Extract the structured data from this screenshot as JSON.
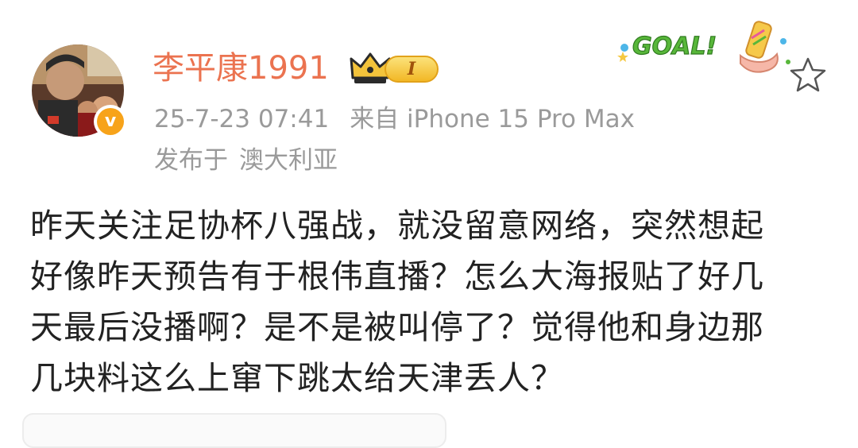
{
  "post": {
    "username": "李平康1991",
    "level_badge": "I",
    "verified_badge": "v",
    "timestamp": "25-7-23 07:41",
    "source": "来自 iPhone 15 Pro Max",
    "location_prefix": "发布于",
    "location": "澳大利亚",
    "sticker_text": "GOAL!",
    "content_lines": [
      "昨天关注足协杯八强战，就没留意网络，突然想起",
      "好像昨天预告有于根伟直播？怎么大海报贴了好几",
      "天最后没播啊？是不是被叫停了？觉得他和身边那",
      "几块料这么上窜下跳太给天津丢人？"
    ]
  },
  "colors": {
    "username": "#eb7350",
    "meta_text": "#9a9a9a",
    "body_text": "#222222",
    "verified": "#f7a31a",
    "sticker_green": "#58b73a"
  },
  "icons": {
    "crown": "crown-icon",
    "favorite": "star-outline-icon",
    "verified": "verified-v-icon",
    "sticker": "goal-sticker-icon"
  }
}
